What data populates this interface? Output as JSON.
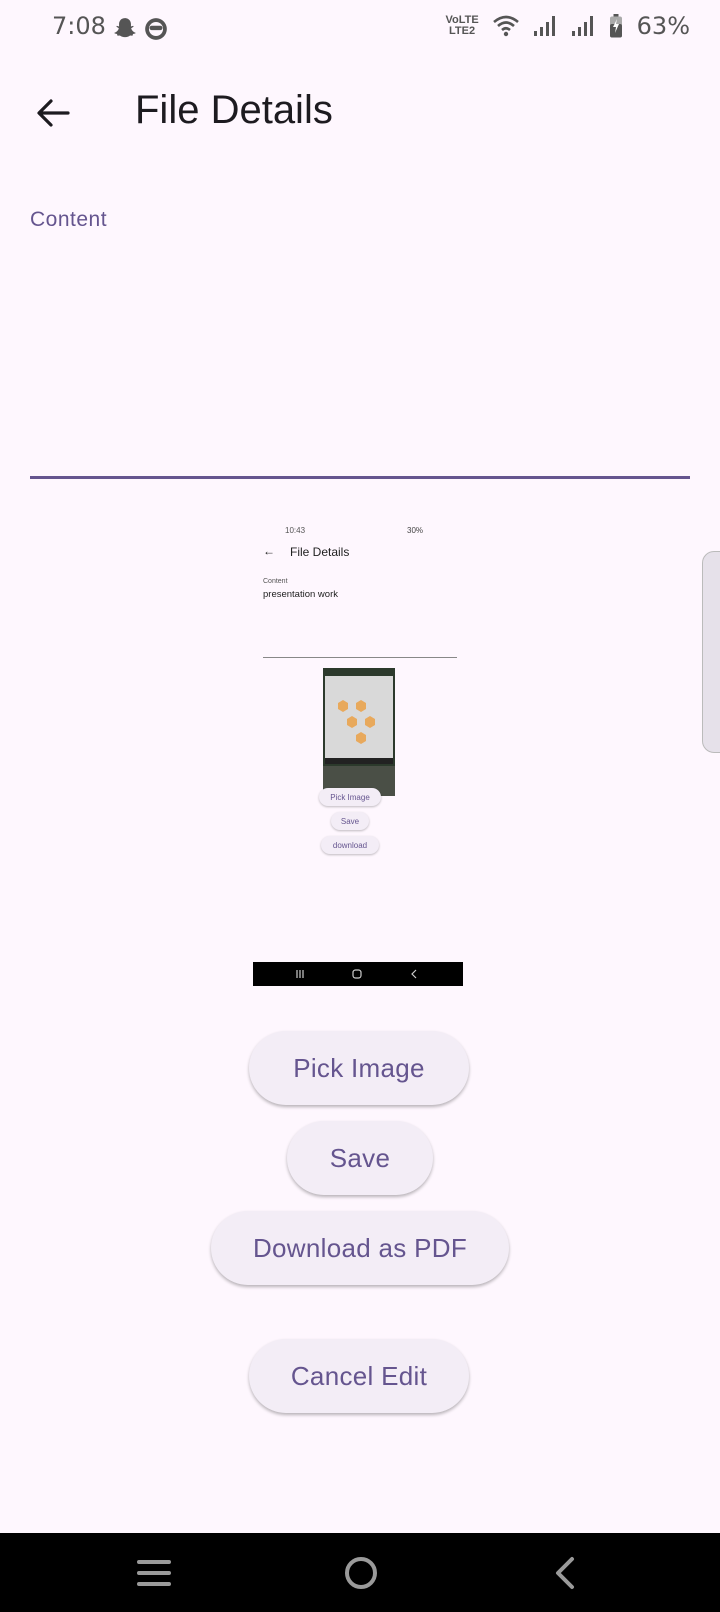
{
  "status_bar": {
    "time": "7:08",
    "battery_percent": "63%",
    "network_label_top": "VoLTE",
    "network_label_bottom": "LTE2"
  },
  "app_bar": {
    "title": "File Details",
    "back_icon": "arrow-back-icon"
  },
  "form": {
    "content_label": "Content",
    "content_value": "",
    "accent_color": "#65558f"
  },
  "embedded_image": {
    "status_time": "10:43",
    "status_right": "30%",
    "title": "File Details",
    "content_label": "Content",
    "content_value": "presentation work",
    "buttons": [
      "Pick Image",
      "Save",
      "download"
    ]
  },
  "actions": {
    "pick_image": "Pick Image",
    "save": "Save",
    "download_pdf": "Download as PDF",
    "cancel_edit": "Cancel Edit"
  },
  "nav_bar": {
    "recents_icon": "recents-icon",
    "home_icon": "home-icon",
    "back_icon": "nav-back-icon"
  }
}
